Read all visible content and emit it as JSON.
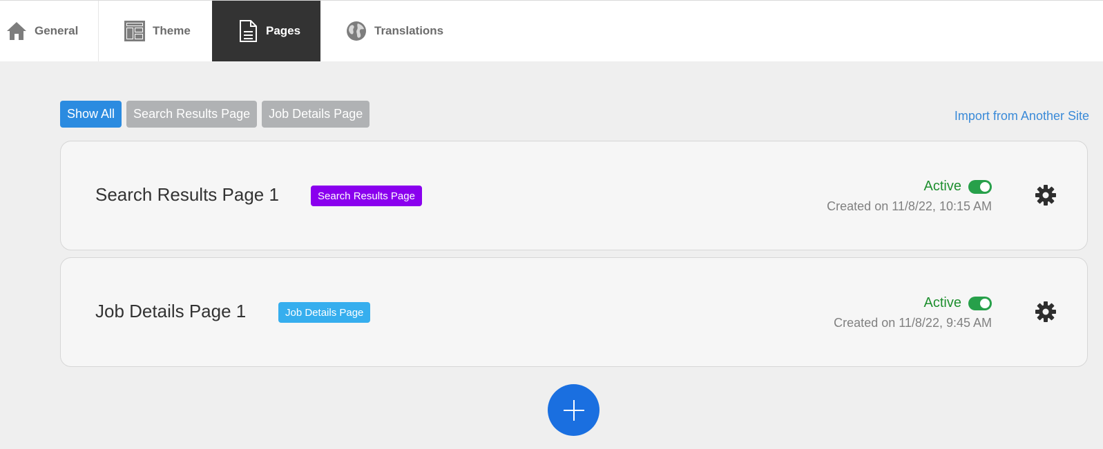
{
  "tabs": [
    {
      "label": "General",
      "icon": "home-icon"
    },
    {
      "label": "Theme",
      "icon": "layout-icon"
    },
    {
      "label": "Pages",
      "icon": "document-icon",
      "active": true
    },
    {
      "label": "Translations",
      "icon": "globe-icon"
    }
  ],
  "filters": [
    {
      "label": "Show All",
      "active": true
    },
    {
      "label": "Search Results Page",
      "active": false
    },
    {
      "label": "Job Details Page",
      "active": false
    }
  ],
  "import_link": "Import from Another Site",
  "pages": [
    {
      "title": "Search Results Page 1",
      "badge": "Search Results Page",
      "badge_color": "#8a00ee",
      "status": "Active",
      "enabled": true,
      "created": "Created on 11/8/22, 10:15 AM"
    },
    {
      "title": "Job Details Page 1",
      "badge": "Job Details Page",
      "badge_color": "#36aeee",
      "status": "Active",
      "enabled": true,
      "created": "Created on 11/8/22, 9:45 AM"
    }
  ],
  "colors": {
    "active_tab_bg": "#333333",
    "primary": "#2b8be0",
    "add_button": "#1a6fe0",
    "status_green": "#1f8f2f",
    "toggle_green": "#27a04a"
  }
}
